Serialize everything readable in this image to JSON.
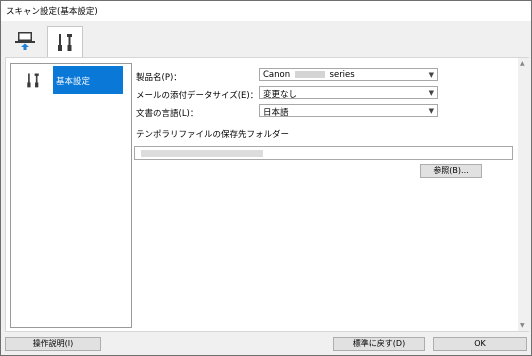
{
  "window": {
    "title": "スキャン設定(基本設定)"
  },
  "tabs": [
    {
      "name": "scan-from-computer",
      "icon": "computer-scan-icon"
    },
    {
      "name": "general-settings",
      "icon": "tools-icon"
    }
  ],
  "sidebar": {
    "items": [
      {
        "label": "基本設定",
        "icon": "tools-icon",
        "selected": true
      }
    ]
  },
  "form": {
    "product": {
      "label": "製品名(P)：",
      "value_prefix": "Canon",
      "value_suffix": "series"
    },
    "attachment_size": {
      "label": "メールの添付データサイズ(E)：",
      "value": "変更なし"
    },
    "language": {
      "label": "文書の言語(L)：",
      "value": "日本語"
    },
    "temp_folder": {
      "label": "テンポラリファイルの保存先フォルダー"
    },
    "browse_label": "参照(B)..."
  },
  "footer": {
    "help_label": "操作説明(I)",
    "default_label": "標準に戻す(D)",
    "ok_label": "OK"
  },
  "colors": {
    "accent": "#0a78d7"
  }
}
